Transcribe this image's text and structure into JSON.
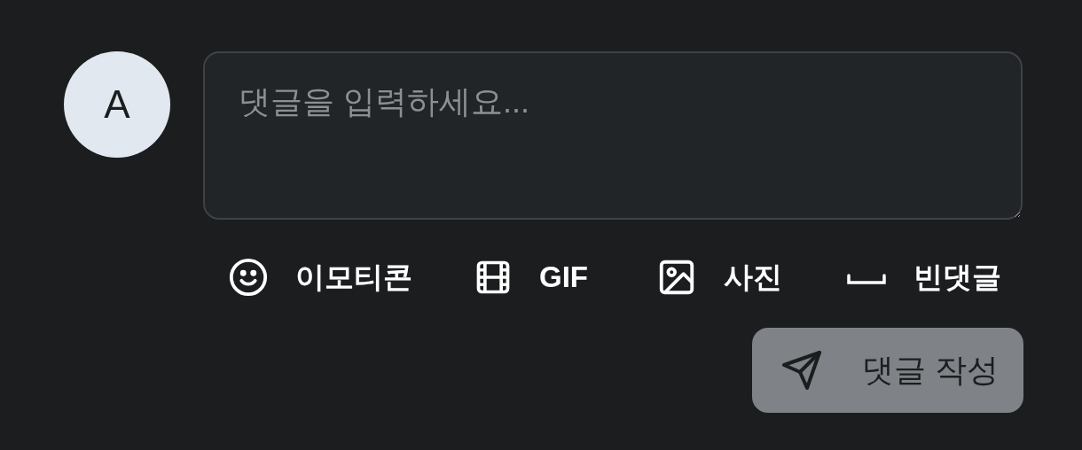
{
  "avatar": {
    "initial": "A"
  },
  "comment_field": {
    "placeholder": "댓글을 입력하세요..."
  },
  "toolbar": [
    {
      "kind": "emoji",
      "label": "이모티콘"
    },
    {
      "kind": "gif",
      "label": "GIF"
    },
    {
      "kind": "photo",
      "label": "사진"
    },
    {
      "kind": "blank",
      "label": "빈댓글"
    }
  ],
  "submit_button": {
    "label": "댓글 작성",
    "disabled": true
  }
}
